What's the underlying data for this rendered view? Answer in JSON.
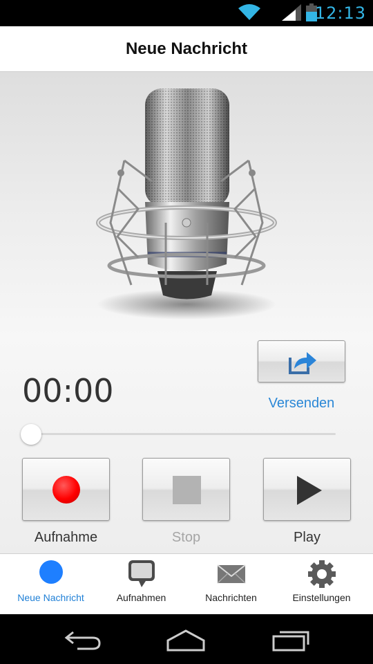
{
  "status_bar": {
    "time": "12:13"
  },
  "header": {
    "title": "Neue Nachricht"
  },
  "recorder": {
    "timer": "00:00",
    "send_label": "Versenden",
    "progress": 0,
    "controls": [
      {
        "label": "Aufnahme",
        "icon": "record-icon",
        "enabled": true
      },
      {
        "label": "Stop",
        "icon": "stop-icon",
        "enabled": false
      },
      {
        "label": "Play",
        "icon": "play-icon",
        "enabled": true
      }
    ]
  },
  "tabs": [
    {
      "label": "Neue Nachricht",
      "icon": "record-dot-icon",
      "active": true
    },
    {
      "label": "Aufnahmen",
      "icon": "speech-bubble-icon",
      "active": false
    },
    {
      "label": "Nachrichten",
      "icon": "envelope-icon",
      "active": false
    },
    {
      "label": "Einstellungen",
      "icon": "gear-icon",
      "active": false
    }
  ],
  "colors": {
    "accent": "#1e7fd6",
    "record": "#ff0000",
    "status_time": "#33b5e5"
  }
}
